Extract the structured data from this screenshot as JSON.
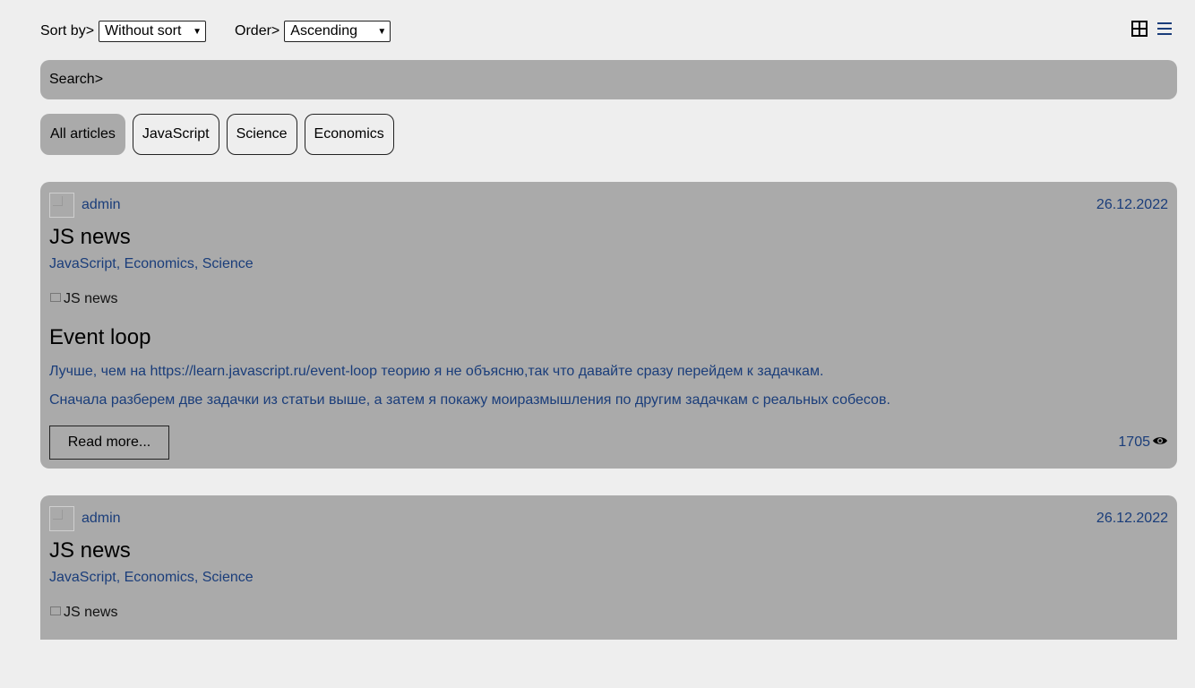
{
  "toolbar": {
    "sort_label": "Sort by>",
    "sort_value": "Without sort",
    "order_label": "Order>",
    "order_value": "Ascending"
  },
  "view_toggle": {
    "grid_icon": "grid-icon",
    "list_icon": "list-icon"
  },
  "search": {
    "label": "Search>",
    "value": ""
  },
  "tags": [
    {
      "label": "All articles",
      "active": true
    },
    {
      "label": "JavaScript"
    },
    {
      "label": "Science"
    },
    {
      "label": "Economics"
    }
  ],
  "articles": [
    {
      "author": "admin",
      "date": "26.12.2022",
      "title": "JS news",
      "categories": "JavaScript, Economics, Science",
      "image_alt": "JS news",
      "block_title": "Event loop",
      "paragraphs": [
        "Лучше, чем на https://learn.javascript.ru/event-loop теорию я не объясню,так что давайте сразу перейдем к задачкам.",
        "Сначала разберем две задачки из статьи выше, а затем я покажу моиразмышления по другим задачкам с реальных собесов."
      ],
      "read_more": "Read more...",
      "views": "1705"
    },
    {
      "author": "admin",
      "date": "26.12.2022",
      "title": "JS news",
      "categories": "JavaScript, Economics, Science",
      "image_alt": "JS news"
    }
  ],
  "colors": {
    "page_bg": "#eeeeee",
    "card_bg": "#aaaaaa",
    "link": "#1a3d7a"
  }
}
